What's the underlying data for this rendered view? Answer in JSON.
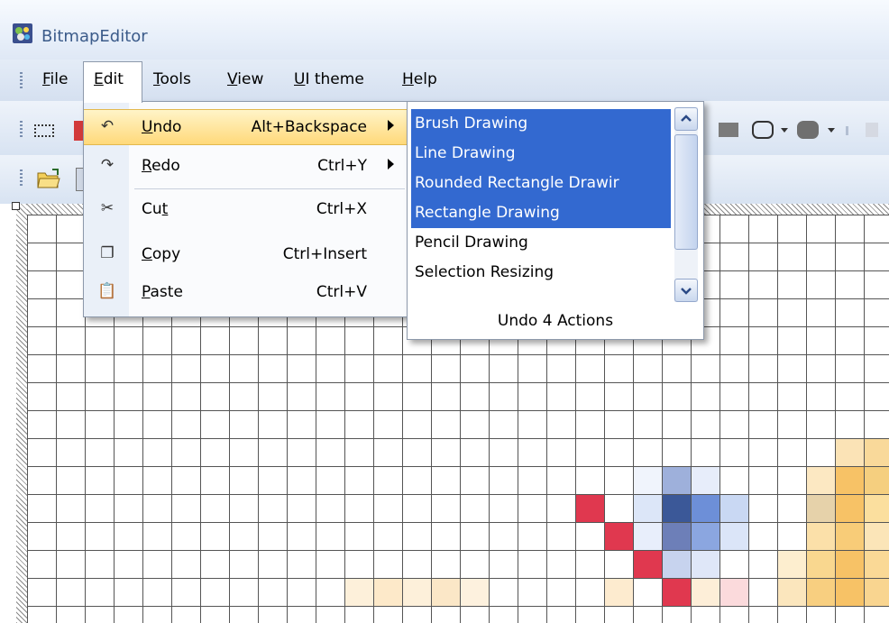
{
  "window": {
    "title": "BitmapEditor"
  },
  "menubar": {
    "items": [
      {
        "label": "File",
        "mnemonic": "F",
        "rest": "ile"
      },
      {
        "label": "Edit",
        "mnemonic": "E",
        "rest": "dit"
      },
      {
        "label": "Tools",
        "mnemonic": "T",
        "rest": "ools"
      },
      {
        "label": "View",
        "mnemonic": "V",
        "rest": "iew"
      },
      {
        "label": "UI theme",
        "mnemonic": "U",
        "rest": "I theme"
      },
      {
        "label": "Help",
        "mnemonic": "H",
        "rest": "elp"
      }
    ]
  },
  "edit_menu": {
    "items": [
      {
        "label": "Undo",
        "shortcut": "Alt+Backspace",
        "icon": "undo-icon",
        "submenu": true,
        "highlighted": true
      },
      {
        "label": "Redo",
        "shortcut": "Ctrl+Y",
        "icon": "redo-icon",
        "submenu": true
      },
      {
        "label": "Cut",
        "shortcut": "Ctrl+X",
        "icon": "cut-icon"
      },
      {
        "label": "Copy",
        "shortcut": "Ctrl+Insert",
        "icon": "copy-icon"
      },
      {
        "label": "Paste",
        "shortcut": "Ctrl+V",
        "icon": "paste-icon"
      }
    ]
  },
  "undo_popup": {
    "items": [
      {
        "label": "Brush Drawing",
        "selected": true
      },
      {
        "label": "Line Drawing",
        "selected": true
      },
      {
        "label": "Rounded Rectangle Drawir",
        "selected": true
      },
      {
        "label": "Rectangle Drawing",
        "selected": true
      },
      {
        "label": "Pencil Drawing",
        "selected": false
      },
      {
        "label": "Selection Resizing",
        "selected": false
      }
    ],
    "footer": "Undo 4 Actions"
  },
  "colors": {
    "selection": "#3369d0",
    "menu_highlight": "#ffd97a",
    "pixel_red": "#e0384f",
    "pixel_navy": "#3b5898",
    "pixel_blue": "#6d8fd8",
    "pixel_light_blue": "#c9d8f3",
    "pixel_orange": "#f7c266"
  }
}
